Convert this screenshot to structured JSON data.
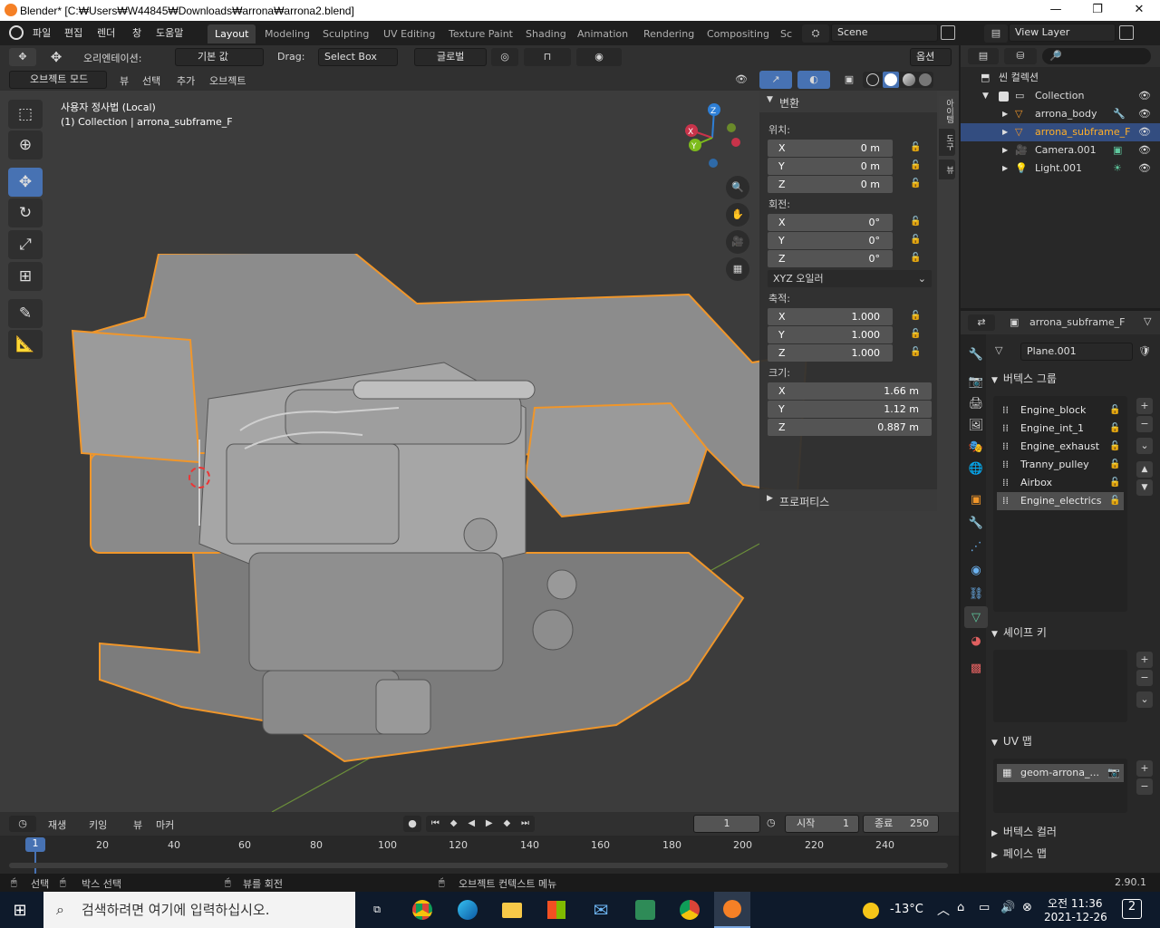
{
  "window": {
    "title": "Blender* [C:₩Users₩W44845₩Downloads₩arrona₩arrona2.blend]",
    "minimize": "—",
    "maximize": "❐",
    "close": "✕"
  },
  "menu": {
    "file": "파일",
    "edit": "편집",
    "render": "렌더",
    "window": "창",
    "help": "도움말"
  },
  "workspaces": [
    "Layout",
    "Modeling",
    "Sculpting",
    "UV Editing",
    "Texture Paint",
    "Shading",
    "Animation",
    "Rendering",
    "Compositing",
    "Sc"
  ],
  "scene": {
    "name": "Scene",
    "view_layer": "View Layer"
  },
  "tool_header": {
    "orientation_label": "오리엔테이션:",
    "orientation_value": "기본 값",
    "drag_label": "Drag:",
    "drag_value": "Select Box",
    "transform_orientation": "글로벌",
    "options": "옵션"
  },
  "viewport_header": {
    "mode": "오브젝트 모드",
    "view": "뷰",
    "select": "선택",
    "add": "추가",
    "object": "오브젝트"
  },
  "viewport": {
    "view_name": "사용자 정사법 (Local)",
    "object_info": "(1) Collection | arrona_subframe_F"
  },
  "gizmo": {
    "x": "X",
    "y": "Y",
    "z": "Z"
  },
  "npanel": {
    "header": "변환",
    "tabs": [
      "아이템",
      "도구",
      "뷰"
    ],
    "location_label": "위치:",
    "location": [
      {
        "axis": "X",
        "value": "0 m"
      },
      {
        "axis": "Y",
        "value": "0 m"
      },
      {
        "axis": "Z",
        "value": "0 m"
      }
    ],
    "rotation_label": "회전:",
    "rotation": [
      {
        "axis": "X",
        "value": "0°"
      },
      {
        "axis": "Y",
        "value": "0°"
      },
      {
        "axis": "Z",
        "value": "0°"
      }
    ],
    "rotation_mode": "XYZ 오일러",
    "scale_label": "축적:",
    "scale": [
      {
        "axis": "X",
        "value": "1.000"
      },
      {
        "axis": "Y",
        "value": "1.000"
      },
      {
        "axis": "Z",
        "value": "1.000"
      }
    ],
    "dimensions_label": "크기:",
    "dimensions": [
      {
        "axis": "X",
        "value": "1.66 m"
      },
      {
        "axis": "Y",
        "value": "1.12 m"
      },
      {
        "axis": "Z",
        "value": "0.887 m"
      }
    ],
    "properties": "프로퍼티스"
  },
  "outliner": {
    "scene_collection": "씬 컬렉션",
    "items": [
      {
        "name": "Collection",
        "icon": "collection-icon"
      },
      {
        "name": "arrona_body",
        "icon": "mesh-icon"
      },
      {
        "name": "arrona_subframe_F",
        "icon": "mesh-icon"
      },
      {
        "name": "Camera.001",
        "icon": "camera-icon"
      },
      {
        "name": "Light.001",
        "icon": "light-icon"
      }
    ]
  },
  "properties": {
    "object_name": "arrona_subframe_F",
    "mesh_name": "Plane.001",
    "vertex_groups_title": "버텍스 그룹",
    "vertex_groups": [
      "Engine_block",
      "Engine_int_1",
      "Engine_exhaust",
      "Tranny_pulley",
      "Airbox",
      "Engine_electrics"
    ],
    "shape_keys_title": "셰이프 키",
    "uv_maps_title": "UV 맵",
    "uv_map": "geom-arrona_...",
    "vertex_colors_title": "버텍스 컬러",
    "face_maps_title": "페이스 맵"
  },
  "timeline": {
    "playback": "재생",
    "keying": "키잉",
    "view": "뷰",
    "marker": "마커",
    "current_frame": "1",
    "start_label": "시작",
    "start": "1",
    "end_label": "종료",
    "end": "250",
    "ticks": [
      "1",
      "20",
      "40",
      "60",
      "80",
      "100",
      "120",
      "140",
      "160",
      "180",
      "200",
      "220",
      "240"
    ]
  },
  "statusbar": {
    "select": "선택",
    "box_select": "박스 선택",
    "rotate_view": "뷰를 회전",
    "context_menu": "오브젝트 컨텍스트 메뉴",
    "version": "2.90.1"
  },
  "taskbar": {
    "search_placeholder": "검색하려면 여기에 입력하십시오.",
    "weather": "-13°C",
    "time": "오전 11:36",
    "date": "2021-12-26",
    "notifications": "2"
  },
  "colors": {
    "accent": "#4772b3",
    "selection_outline": "#f0962a",
    "active_text": "#ffaf29"
  }
}
